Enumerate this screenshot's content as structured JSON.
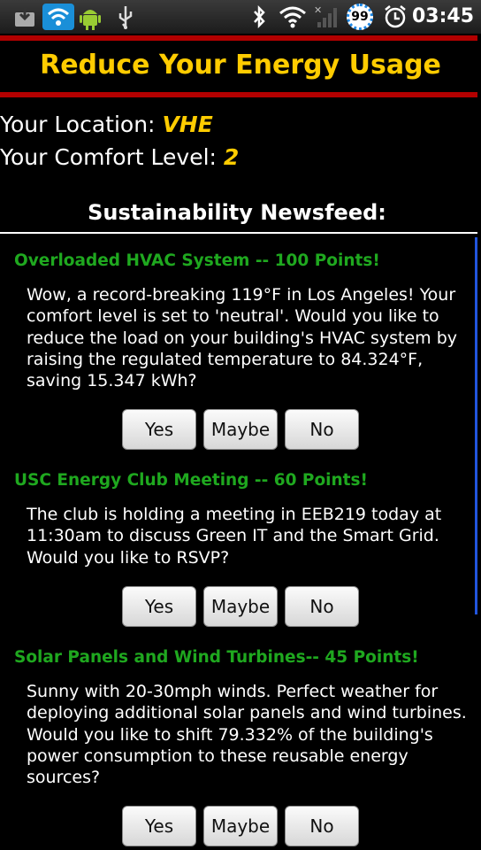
{
  "status_bar": {
    "icons": [
      "download-icon",
      "wifi-app-icon",
      "android-icon",
      "usb-icon",
      "bluetooth-icon",
      "wifi-icon",
      "signal-icon"
    ],
    "battery": "99",
    "time": "03:45"
  },
  "header": {
    "title": "Reduce Your Energy Usage"
  },
  "info": {
    "location_label": "Your Location: ",
    "location_value": "VHE",
    "comfort_label": "Your Comfort Level: ",
    "comfort_value": "2"
  },
  "newsfeed": {
    "heading": "Sustainability Newsfeed:",
    "items": [
      {
        "title": "Overloaded HVAC System -- 100 Points!",
        "body": "Wow, a record-breaking 119°F in Los Angeles! Your comfort level is set to 'neutral'. Would you like to reduce the load on your building's HVAC system by raising the regulated temperature to 84.324°F, saving 15.347 kWh?",
        "buttons": [
          "Yes",
          "Maybe",
          "No"
        ]
      },
      {
        "title": "USC Energy Club Meeting -- 60 Points!",
        "body": "The club is holding a meeting in EEB219 today at 11:30am to discuss Green IT and the Smart Grid. Would you like to RSVP?",
        "buttons": [
          "Yes",
          "Maybe",
          "No"
        ]
      },
      {
        "title": "Solar Panels and Wind Turbines-- 45 Points!",
        "body": "Sunny with 20-30mph winds. Perfect weather for deploying additional solar panels and wind turbines. Would you like to shift 79.332% of the building's power consumption to these reusable energy sources?",
        "buttons": [
          "Yes",
          "Maybe",
          "No"
        ]
      }
    ]
  },
  "colors": {
    "title": "#ffcc00",
    "accent_red": "#b30000",
    "item_title": "#1fa81f"
  }
}
